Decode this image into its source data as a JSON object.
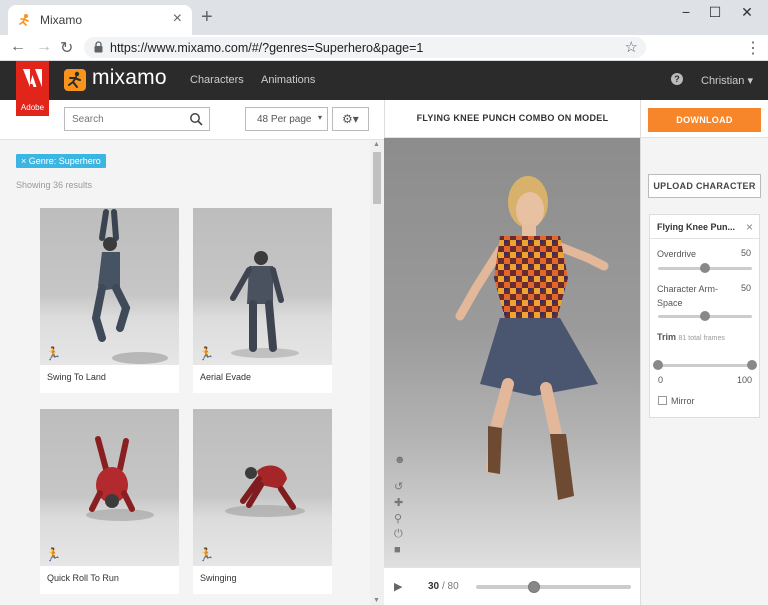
{
  "browser": {
    "tab_title": "Mixamo",
    "tab_close": "×",
    "new_tab": "+",
    "window_minimize": "−",
    "window_maximize": "☐",
    "window_close": "✕",
    "url": "https://www.mixamo.com/#/?genres=Superhero&page=1",
    "back": "←",
    "forward": "→",
    "reload": "↻",
    "star": "☆",
    "menu": "⋮"
  },
  "header": {
    "adobe_label": "Adobe",
    "brand": "mixamo",
    "nav": [
      "Characters",
      "Animations"
    ],
    "help": "?",
    "user": "Christian ▾"
  },
  "toolbar": {
    "search_placeholder": "Search",
    "per_page": "48 Per page",
    "per_page_caret": "▾",
    "settings_glyph": "⚙▾"
  },
  "filters": {
    "tag": "× Genre: Superhero",
    "results": "Showing 36 results"
  },
  "cards": [
    {
      "label": "Swing To Land"
    },
    {
      "label": "Aerial Evade"
    },
    {
      "label": "Quick Roll To Run"
    },
    {
      "label": "Swinging"
    }
  ],
  "viewer": {
    "title": "FLYING KNEE PUNCH COMBO ON MODEL",
    "tools": [
      "☻",
      "↺",
      "✚",
      "⚲",
      "⏻",
      "■"
    ],
    "play": "▶",
    "frame_current": "30",
    "frame_total": "/ 80",
    "frame_progress": 0.375
  },
  "panel": {
    "download": "DOWNLOAD",
    "upload": "UPLOAD CHARACTER",
    "settings_title": "Flying Knee Pun...",
    "close": "×",
    "overdrive_label": "Overdrive",
    "overdrive_value": "50",
    "overdrive_level": 0.5,
    "arm_space_label": "Character Arm-Space",
    "arm_space_value": "50",
    "arm_space_level": 0.5,
    "trim_label": "Trim",
    "trim_sub": "81 total frames",
    "trim_min": "0",
    "trim_max": "100",
    "trim_start": 0,
    "trim_end": 1,
    "mirror_label": "Mirror"
  },
  "colors": {
    "accent_orange": "#f7862b",
    "tag_blue": "#3bb6e3",
    "adobe_red": "#e1251b",
    "header_dark": "#2b2b2b"
  }
}
